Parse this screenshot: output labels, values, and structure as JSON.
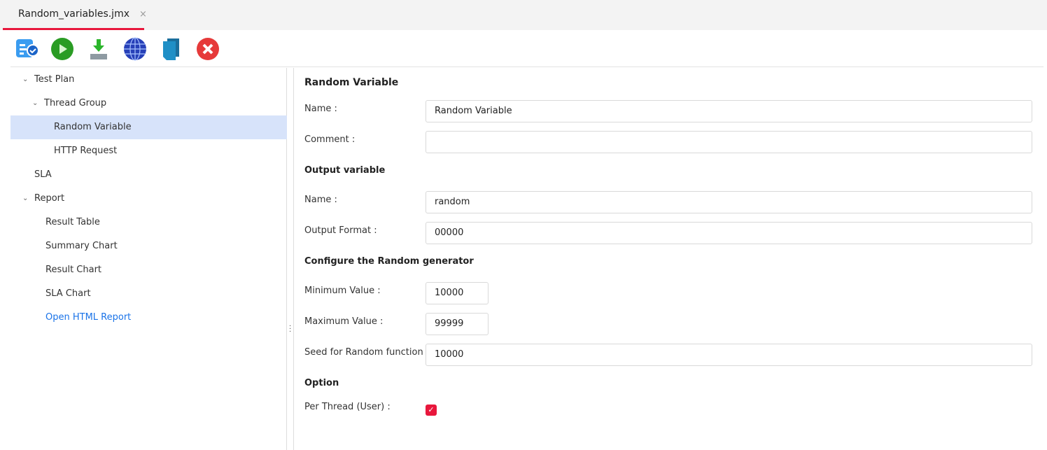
{
  "tab": {
    "title": "Random_variables.jmx",
    "close": "×"
  },
  "toolbar": {
    "icons": [
      "list-check-icon",
      "play-icon",
      "download-icon",
      "globe-icon",
      "copy-icon",
      "stop-icon"
    ],
    "colors": {
      "accent": "#e8173c",
      "selected": "#d7e3fa",
      "link": "#1a73e8"
    }
  },
  "tree": {
    "items": [
      {
        "label": "Test Plan"
      },
      {
        "label": "Thread Group"
      },
      {
        "label": "Random Variable"
      },
      {
        "label": "HTTP Request"
      },
      {
        "label": "SLA"
      },
      {
        "label": "Report"
      },
      {
        "label": "Result Table"
      },
      {
        "label": "Summary Chart"
      },
      {
        "label": "Result Chart"
      },
      {
        "label": "SLA Chart"
      },
      {
        "label": "Open HTML Report"
      }
    ]
  },
  "form": {
    "title": "Random Variable",
    "name_label": "Name :",
    "name_value": "Random Variable",
    "comment_label": "Comment :",
    "comment_value": "",
    "output_section": "Output variable",
    "var_name_label": "Name :",
    "var_name_value": "random",
    "format_label": "Output Format :",
    "format_value": "00000",
    "config_section": "Configure the Random generator",
    "min_label": "Minimum Value :",
    "min_value": "10000",
    "max_label": "Maximum Value :",
    "max_value": "99999",
    "seed_label": "Seed for Random function :",
    "seed_value": "10000",
    "option_section": "Option",
    "per_thread_label": "Per Thread (User) :",
    "per_thread_checked": true
  }
}
